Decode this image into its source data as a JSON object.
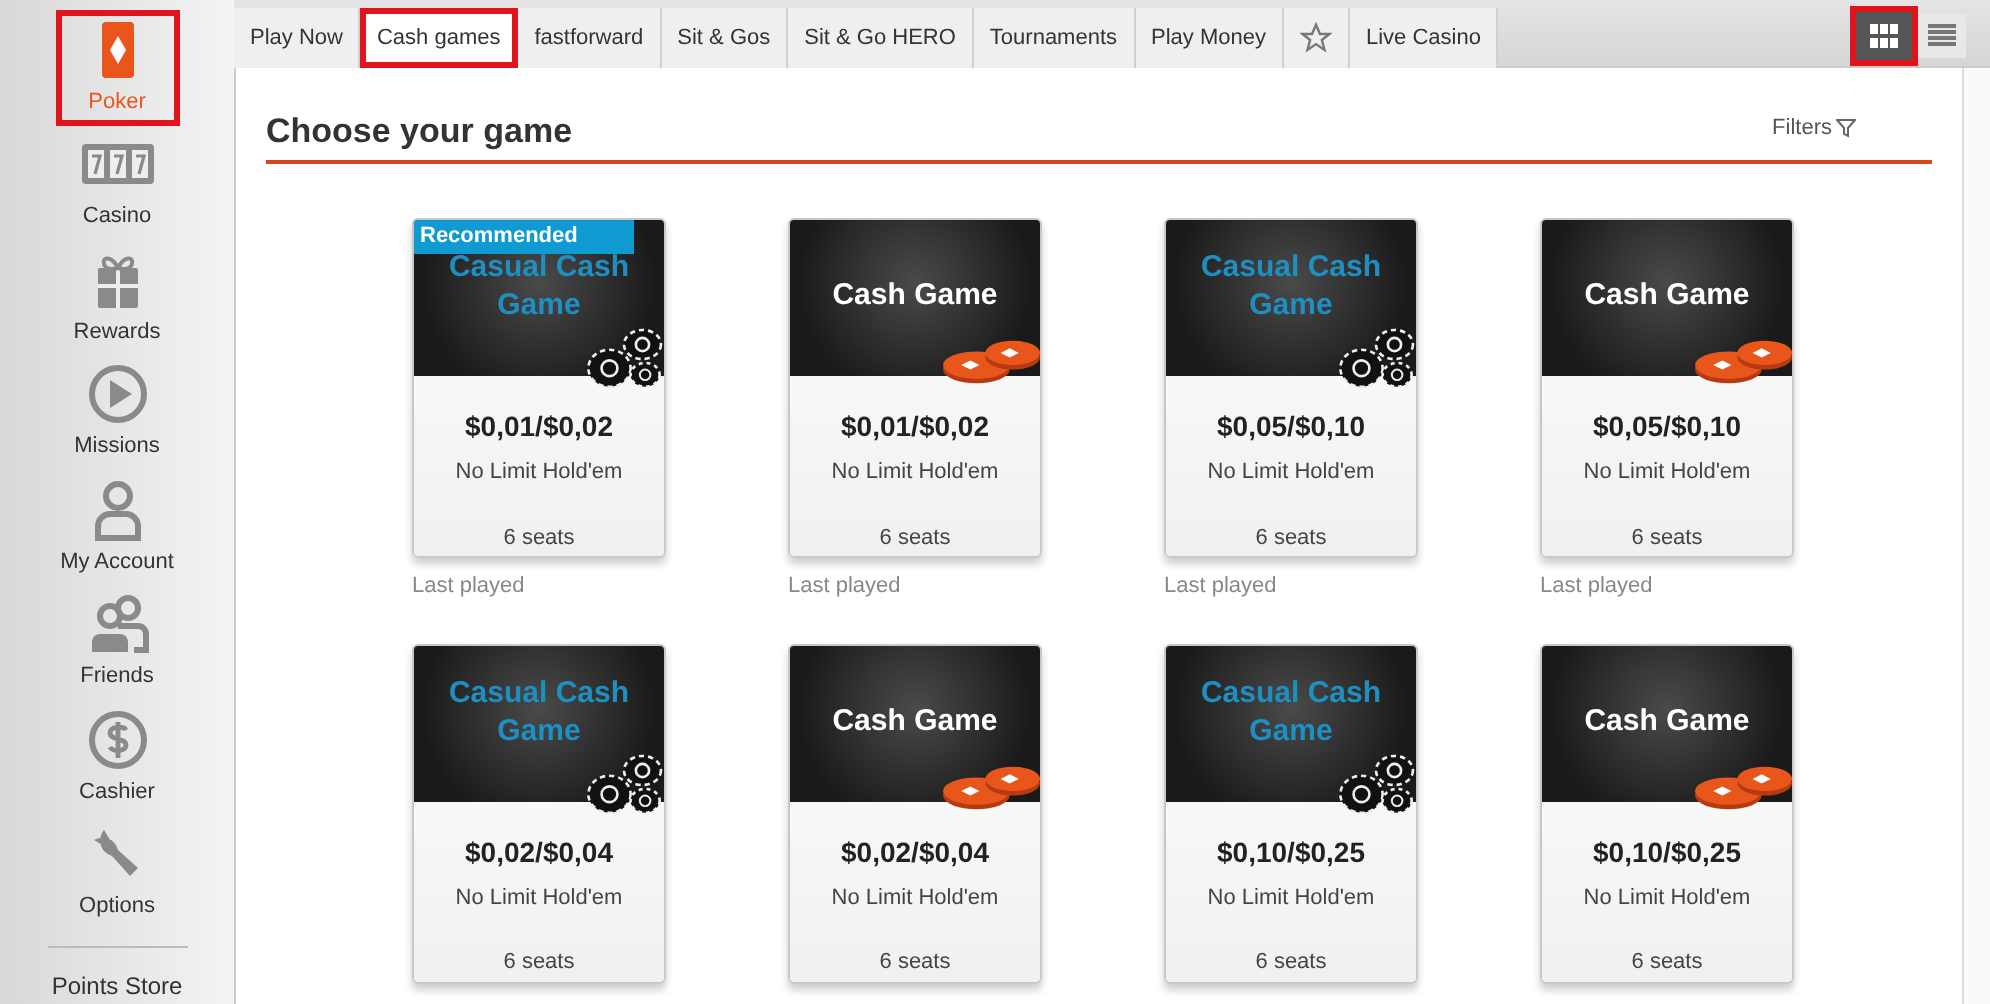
{
  "sidebar": {
    "items": [
      {
        "kind": "poker",
        "label": "Poker",
        "selected": true,
        "highlighted": true
      },
      {
        "kind": "casino",
        "label": "Casino",
        "selected": false,
        "highlighted": false
      },
      {
        "kind": "rewards",
        "label": "Rewards",
        "selected": false,
        "highlighted": false
      },
      {
        "kind": "missions",
        "label": "Missions",
        "selected": false,
        "highlighted": false
      },
      {
        "kind": "account",
        "label": "My Account",
        "selected": false,
        "highlighted": false
      },
      {
        "kind": "friends",
        "label": "Friends",
        "selected": false,
        "highlighted": false
      },
      {
        "kind": "cashier",
        "label": "Cashier",
        "selected": false,
        "highlighted": false
      },
      {
        "kind": "options",
        "label": "Options",
        "selected": false,
        "highlighted": false
      }
    ],
    "footer": "Points Store"
  },
  "tabs": [
    {
      "kind": "text",
      "label": "Play Now",
      "selected": false,
      "highlighted": false
    },
    {
      "kind": "text",
      "label": "Cash games",
      "selected": true,
      "highlighted": true
    },
    {
      "kind": "text",
      "label": "fastforward",
      "selected": false,
      "highlighted": false
    },
    {
      "kind": "text",
      "label": "Sit & Gos",
      "selected": false,
      "highlighted": false
    },
    {
      "kind": "text",
      "label": "Sit & Go HERO",
      "selected": false,
      "highlighted": false
    },
    {
      "kind": "text",
      "label": "Tournaments",
      "selected": false,
      "highlighted": false
    },
    {
      "kind": "text",
      "label": "Play Money",
      "selected": false,
      "highlighted": false
    },
    {
      "kind": "star",
      "selected": false,
      "highlighted": false
    },
    {
      "kind": "text",
      "label": "Live Casino",
      "selected": false,
      "highlighted": false
    }
  ],
  "view_toggle": [
    {
      "kind": "grid",
      "selected": true,
      "highlighted": true
    },
    {
      "kind": "list",
      "selected": false,
      "highlighted": false
    }
  ],
  "heading": "Choose your game",
  "filters": "Filters",
  "games": [
    {
      "kind": "casual",
      "badge": "Recommended",
      "title": "Casual Cash Game",
      "stakes": "$0,01/$0,02",
      "variant": "No Limit Hold'em",
      "seats": "6 seats",
      "note": "Last played"
    },
    {
      "kind": "cash",
      "title": "Cash Game",
      "stakes": "$0,01/$0,02",
      "variant": "No Limit Hold'em",
      "seats": "6 seats",
      "note": "Last played"
    },
    {
      "kind": "casual",
      "title": "Casual Cash Game",
      "stakes": "$0,05/$0,10",
      "variant": "No Limit Hold'em",
      "seats": "6 seats",
      "note": "Last played"
    },
    {
      "kind": "cash",
      "title": "Cash Game",
      "stakes": "$0,05/$0,10",
      "variant": "No Limit Hold'em",
      "seats": "6 seats",
      "note": "Last played"
    },
    {
      "kind": "casual",
      "title": "Casual Cash Game",
      "stakes": "$0,02/$0,04",
      "variant": "No Limit Hold'em",
      "seats": "6 seats"
    },
    {
      "kind": "cash",
      "title": "Cash Game",
      "stakes": "$0,02/$0,04",
      "variant": "No Limit Hold'em",
      "seats": "6 seats"
    },
    {
      "kind": "casual",
      "title": "Casual Cash Game",
      "stakes": "$0,10/$0,25",
      "variant": "No Limit Hold'em",
      "seats": "6 seats"
    },
    {
      "kind": "cash",
      "title": "Cash Game",
      "stakes": "$0,10/$0,25",
      "variant": "No Limit Hold'em",
      "seats": "6 seats"
    }
  ]
}
